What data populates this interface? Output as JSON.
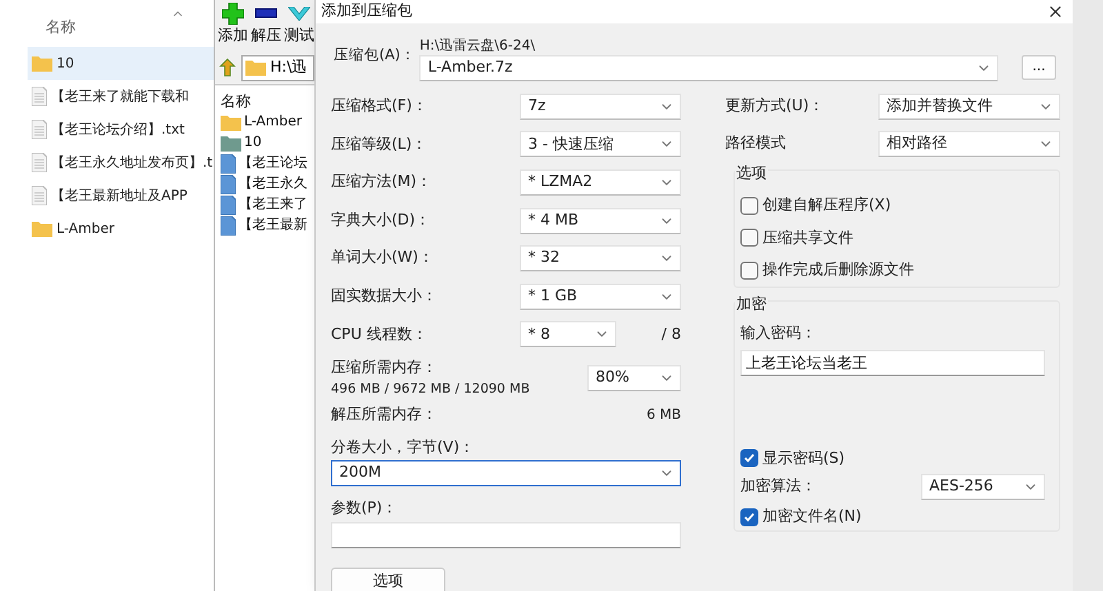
{
  "explorer": {
    "column_header": "名称",
    "rows": [
      {
        "kind": "folder",
        "name": "10",
        "selected": true
      },
      {
        "kind": "file",
        "name": "【老王来了就能下载和",
        "selected": false
      },
      {
        "kind": "file",
        "name": "【老王论坛介绍】.txt",
        "selected": false
      },
      {
        "kind": "file",
        "name": "【老王永久地址发布页】.t",
        "selected": false
      },
      {
        "kind": "file",
        "name": "【老王最新地址及APP",
        "selected": false
      },
      {
        "kind": "folder",
        "name": "L-Amber",
        "selected": false
      }
    ]
  },
  "archiver": {
    "toolbar": [
      {
        "kind": "add",
        "label": "添加"
      },
      {
        "kind": "extract",
        "label": "解压"
      },
      {
        "kind": "test",
        "label": "测试"
      }
    ],
    "address": "H:\\迅",
    "column_header": "名称",
    "items": [
      {
        "kind": "folder",
        "name": "L-Amber"
      },
      {
        "kind": "folder-dark",
        "name": "10"
      },
      {
        "kind": "file",
        "name": "【老王论坛"
      },
      {
        "kind": "file",
        "name": "【老王永久"
      },
      {
        "kind": "file",
        "name": "【老王来了"
      },
      {
        "kind": "file",
        "name": "【老王最新"
      }
    ]
  },
  "dialog": {
    "title": "添加到压缩包",
    "archive_label": "压缩包(A)：",
    "archive_dir": "H:\\迅雷云盘\\6-24\\",
    "archive_name": "L-Amber.7z",
    "browse_button": "...",
    "settings": [
      {
        "label": "压缩格式(F)：",
        "value": "7z"
      },
      {
        "label": "压缩等级(L)：",
        "value": "3 - 快速压缩"
      },
      {
        "label": "压缩方法(M)：",
        "value": "* LZMA2"
      },
      {
        "label": "字典大小(D)：",
        "value": "* 4 MB"
      },
      {
        "label": "单词大小(W)：",
        "value": "* 32"
      },
      {
        "label": "固实数据大小：",
        "value": "* 1 GB"
      }
    ],
    "cpu": {
      "label": "CPU 线程数：",
      "value": "* 8",
      "max": "/ 8"
    },
    "memory": {
      "label": "压缩所需内存：",
      "detail": "496 MB / 9672 MB / 12090 MB",
      "value": "80%"
    },
    "decompress_memory": {
      "label": "解压所需内存：",
      "value": "6 MB"
    },
    "volume": {
      "label": "分卷大小，字节(V)：",
      "value": "200M",
      "focused": true
    },
    "parameters": {
      "label": "参数(P)："
    },
    "options_button": "选项",
    "update": [
      {
        "label": "更新方式(U)：",
        "value": "添加并替换文件"
      },
      {
        "label": "路径模式",
        "value": "相对路径"
      }
    ],
    "options": {
      "title": "选项",
      "checkboxes": [
        {
          "label": "创建自解压程序(X)",
          "checked": false
        },
        {
          "label": "压缩共享文件",
          "checked": false
        },
        {
          "label": "操作完成后删除源文件",
          "checked": false
        }
      ]
    },
    "encryption": {
      "title": "加密",
      "password_label": "输入密码：",
      "password": "上老王论坛当老王",
      "show_password": {
        "label": "显示密码(S)",
        "checked": true
      },
      "method_label": "加密算法：",
      "method": "AES-256",
      "encrypt_names": {
        "label": "加密文件名(N)",
        "checked": true
      }
    }
  }
}
